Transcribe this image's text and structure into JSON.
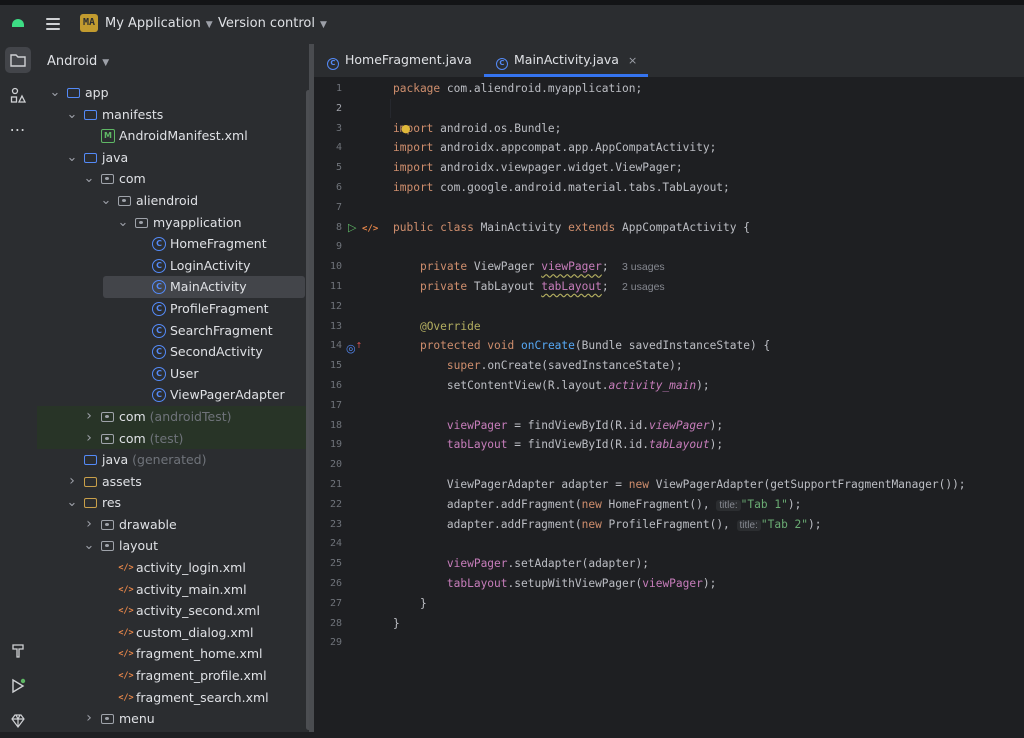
{
  "topbar": {
    "project_badge": "MA",
    "project_name": "My Application",
    "vcs_menu": "Version control"
  },
  "project_panel": {
    "view_mode": "Android",
    "tree": [
      {
        "depth": 0,
        "arrow": "open",
        "icon": "folder-blue",
        "label": "app"
      },
      {
        "depth": 1,
        "arrow": "open",
        "icon": "folder-blue",
        "label": "manifests"
      },
      {
        "depth": 2,
        "arrow": "none",
        "icon": "manifest",
        "label": "AndroidManifest.xml"
      },
      {
        "depth": 1,
        "arrow": "open",
        "icon": "folder-blue",
        "label": "java"
      },
      {
        "depth": 2,
        "arrow": "open",
        "icon": "package",
        "label": "com"
      },
      {
        "depth": 3,
        "arrow": "open",
        "icon": "package",
        "label": "aliendroid"
      },
      {
        "depth": 4,
        "arrow": "open",
        "icon": "package",
        "label": "myapplication"
      },
      {
        "depth": 5,
        "arrow": "none",
        "icon": "class",
        "label": "HomeFragment"
      },
      {
        "depth": 5,
        "arrow": "none",
        "icon": "class",
        "label": "LoginActivity"
      },
      {
        "depth": 5,
        "arrow": "none",
        "icon": "class",
        "label": "MainActivity",
        "selected": true
      },
      {
        "depth": 5,
        "arrow": "none",
        "icon": "class",
        "label": "ProfileFragment"
      },
      {
        "depth": 5,
        "arrow": "none",
        "icon": "class",
        "label": "SearchFragment"
      },
      {
        "depth": 5,
        "arrow": "none",
        "icon": "class",
        "label": "SecondActivity"
      },
      {
        "depth": 5,
        "arrow": "none",
        "icon": "class",
        "label": "User"
      },
      {
        "depth": 5,
        "arrow": "none",
        "icon": "class",
        "label": "ViewPagerAdapter"
      },
      {
        "depth": 2,
        "arrow": "closed",
        "icon": "package",
        "label": "com",
        "suffix": "(androidTest)",
        "test": true
      },
      {
        "depth": 2,
        "arrow": "closed",
        "icon": "package",
        "label": "com",
        "suffix": "(test)",
        "test": true
      },
      {
        "depth": 1,
        "arrow": "none",
        "icon": "folder-gen",
        "label": "java",
        "suffix": "(generated)"
      },
      {
        "depth": 1,
        "arrow": "closed",
        "icon": "folder-res",
        "label": "assets"
      },
      {
        "depth": 1,
        "arrow": "open",
        "icon": "folder-res",
        "label": "res"
      },
      {
        "depth": 2,
        "arrow": "closed",
        "icon": "package",
        "label": "drawable"
      },
      {
        "depth": 2,
        "arrow": "open",
        "icon": "package",
        "label": "layout"
      },
      {
        "depth": 3,
        "arrow": "none",
        "icon": "xml",
        "label": "activity_login.xml"
      },
      {
        "depth": 3,
        "arrow": "none",
        "icon": "xml",
        "label": "activity_main.xml"
      },
      {
        "depth": 3,
        "arrow": "none",
        "icon": "xml",
        "label": "activity_second.xml"
      },
      {
        "depth": 3,
        "arrow": "none",
        "icon": "xml",
        "label": "custom_dialog.xml"
      },
      {
        "depth": 3,
        "arrow": "none",
        "icon": "xml",
        "label": "fragment_home.xml"
      },
      {
        "depth": 3,
        "arrow": "none",
        "icon": "xml",
        "label": "fragment_profile.xml"
      },
      {
        "depth": 3,
        "arrow": "none",
        "icon": "xml",
        "label": "fragment_search.xml"
      },
      {
        "depth": 2,
        "arrow": "closed",
        "icon": "package",
        "label": "menu"
      }
    ]
  },
  "tabs": [
    {
      "label": "HomeFragment.java",
      "active": false
    },
    {
      "label": "MainActivity.java",
      "active": true,
      "close": "×"
    }
  ],
  "editor": {
    "lines": [
      {
        "n": "1",
        "seg": [
          [
            "kw",
            "package "
          ],
          [
            "",
            "com.aliendroid.myapplication;"
          ]
        ]
      },
      {
        "n": "2",
        "seg": []
      },
      {
        "n": "3",
        "seg": [
          [
            "kw",
            "import "
          ],
          [
            "",
            "android.os.Bundle;"
          ]
        ]
      },
      {
        "n": "4",
        "seg": [
          [
            "kw",
            "import "
          ],
          [
            "",
            "androidx.appcompat.app.AppCompatActivity;"
          ]
        ]
      },
      {
        "n": "5",
        "seg": [
          [
            "kw",
            "import "
          ],
          [
            "",
            "androidx.viewpager.widget.ViewPager;"
          ]
        ]
      },
      {
        "n": "6",
        "seg": [
          [
            "kw",
            "import "
          ],
          [
            "",
            "com.google.android.material.tabs.TabLayout;"
          ]
        ]
      },
      {
        "n": "7",
        "seg": []
      },
      {
        "n": "8",
        "seg": [
          [
            "kw",
            "public class "
          ],
          [
            "",
            "MainActivity "
          ],
          [
            "kw",
            "extends "
          ],
          [
            "",
            "AppCompatActivity {"
          ]
        ]
      },
      {
        "n": "9",
        "seg": []
      },
      {
        "n": "10",
        "seg": [
          [
            "",
            "    "
          ],
          [
            "kw",
            "private "
          ],
          [
            "",
            "ViewPager "
          ],
          [
            "fld warn",
            "viewPager"
          ],
          [
            "",
            ";  "
          ],
          [
            "hint",
            "3 usages"
          ]
        ]
      },
      {
        "n": "11",
        "seg": [
          [
            "",
            "    "
          ],
          [
            "kw",
            "private "
          ],
          [
            "",
            "TabLayout "
          ],
          [
            "fld warn",
            "tabLayout"
          ],
          [
            "",
            ";  "
          ],
          [
            "hint",
            "2 usages"
          ]
        ]
      },
      {
        "n": "12",
        "seg": []
      },
      {
        "n": "13",
        "seg": [
          [
            "",
            "    "
          ],
          [
            "ann",
            "@Override"
          ]
        ]
      },
      {
        "n": "14",
        "seg": [
          [
            "",
            "    "
          ],
          [
            "kw",
            "protected void "
          ],
          [
            "fn",
            "onCreate"
          ],
          [
            "",
            "(Bundle savedInstanceState) {"
          ]
        ]
      },
      {
        "n": "15",
        "seg": [
          [
            "",
            "        "
          ],
          [
            "kw",
            "super"
          ],
          [
            "",
            ".onCreate(savedInstanceState);"
          ]
        ]
      },
      {
        "n": "16",
        "seg": [
          [
            "",
            "        setContentView(R.layout."
          ],
          [
            "fldi",
            "activity_main"
          ],
          [
            "",
            ");"
          ]
        ]
      },
      {
        "n": "17",
        "seg": []
      },
      {
        "n": "18",
        "seg": [
          [
            "",
            "        "
          ],
          [
            "fld",
            "viewPager"
          ],
          [
            "",
            " = findViewById(R.id."
          ],
          [
            "fldi",
            "viewPager"
          ],
          [
            "",
            ");"
          ]
        ]
      },
      {
        "n": "19",
        "seg": [
          [
            "",
            "        "
          ],
          [
            "fld",
            "tabLayout"
          ],
          [
            "",
            " = findViewById(R.id."
          ],
          [
            "fldi",
            "tabLayout"
          ],
          [
            "",
            ");"
          ]
        ]
      },
      {
        "n": "20",
        "seg": []
      },
      {
        "n": "21",
        "seg": [
          [
            "",
            "        ViewPagerAdapter adapter = "
          ],
          [
            "kw",
            "new "
          ],
          [
            "",
            "ViewPagerAdapter(getSupportFragmentManager());"
          ]
        ]
      },
      {
        "n": "22",
        "seg": [
          [
            "",
            "        adapter.addFragment("
          ],
          [
            "kw",
            "new "
          ],
          [
            "",
            "HomeFragment(), "
          ],
          [
            "hintbox",
            "title:"
          ],
          [
            "str",
            "\"Tab 1\""
          ],
          [
            "",
            ");"
          ]
        ]
      },
      {
        "n": "23",
        "seg": [
          [
            "",
            "        adapter.addFragment("
          ],
          [
            "kw",
            "new "
          ],
          [
            "",
            "ProfileFragment(), "
          ],
          [
            "hintbox",
            "title:"
          ],
          [
            "str",
            "\"Tab 2\""
          ],
          [
            "",
            ");"
          ]
        ]
      },
      {
        "n": "24",
        "seg": []
      },
      {
        "n": "25",
        "seg": [
          [
            "",
            "        "
          ],
          [
            "fld",
            "viewPager"
          ],
          [
            "",
            ".setAdapter(adapter);"
          ]
        ]
      },
      {
        "n": "26",
        "seg": [
          [
            "",
            "        "
          ],
          [
            "fld",
            "tabLayout"
          ],
          [
            "",
            ".setupWithViewPager("
          ],
          [
            "fld",
            "viewPager"
          ],
          [
            "",
            ");"
          ]
        ]
      },
      {
        "n": "27",
        "seg": [
          [
            "",
            "    }"
          ]
        ]
      },
      {
        "n": "28",
        "seg": [
          [
            "",
            "}"
          ]
        ]
      },
      {
        "n": "29",
        "seg": []
      }
    ]
  },
  "colors": {
    "background": "#1e1f22",
    "panel": "#2b2d30",
    "accent": "#3574f0",
    "keyword": "#cf8e6d",
    "field": "#c77dbb",
    "method": "#56a8f5",
    "string": "#6aab73",
    "annotation": "#b3ae60"
  }
}
